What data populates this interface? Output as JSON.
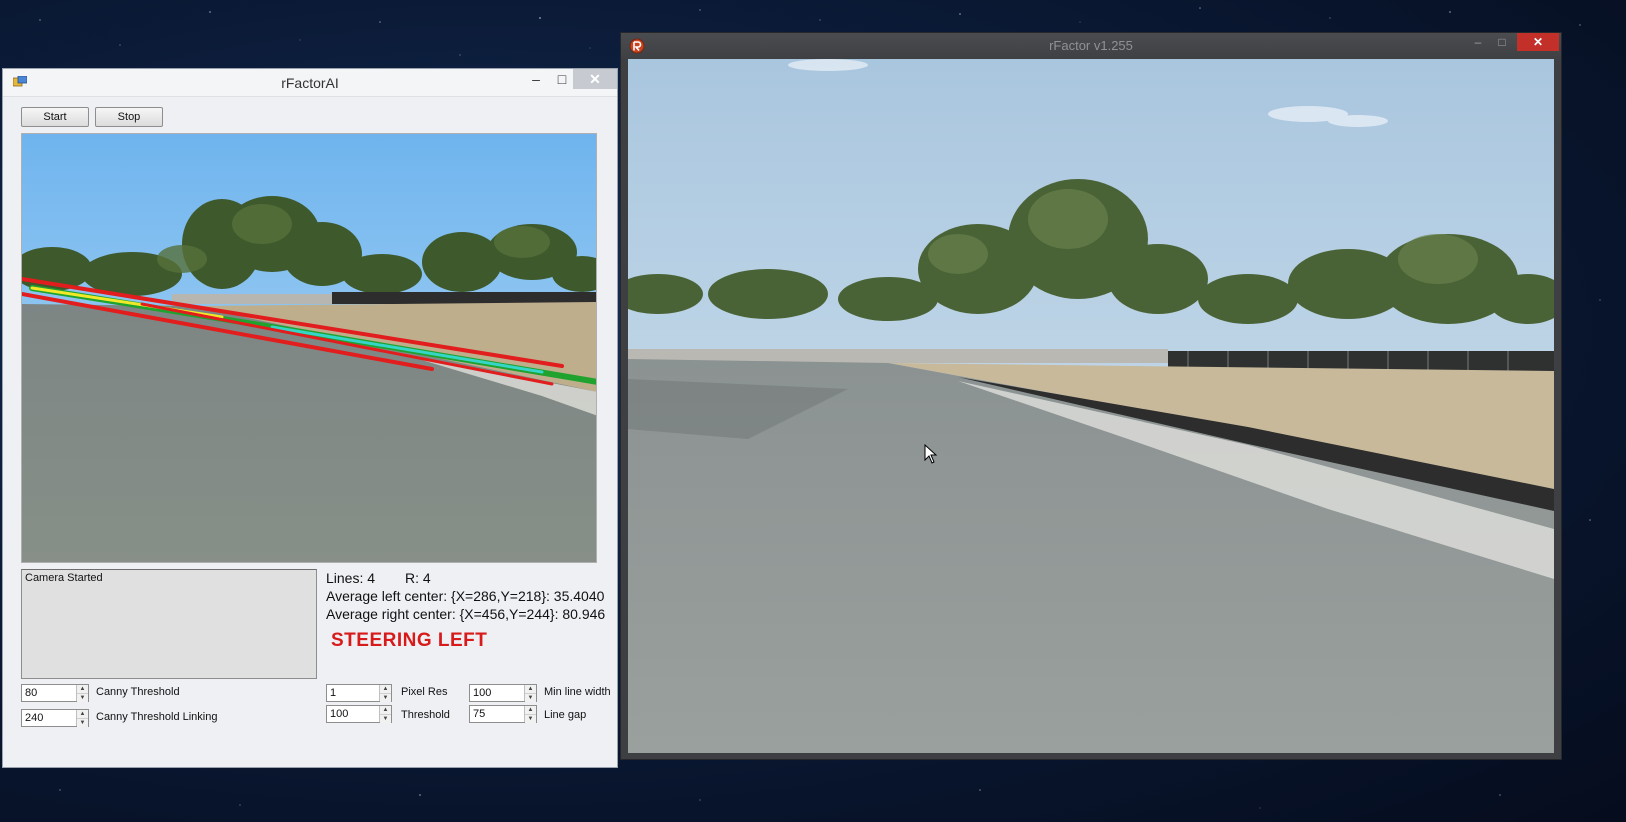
{
  "ai_window": {
    "title": "rFactorAI",
    "minimize_glyph": "–",
    "maximize_glyph": "□",
    "close_glyph": "✕",
    "start_label": "Start",
    "stop_label": "Stop",
    "log_text": "Camera Started",
    "stats": {
      "lines": "Lines: 4",
      "r": "R: 4",
      "avg_left": "Average left center: {X=286,Y=218}: 35.4040",
      "avg_right": "Average right center: {X=456,Y=244}: 80.946"
    },
    "steering_text": "STEERING LEFT",
    "steering_color": "#d81a1a",
    "controls": {
      "canny_threshold": {
        "value": "80",
        "label": "Canny Threshold"
      },
      "canny_threshold_linking": {
        "value": "240",
        "label": "Canny Threshold Linking"
      },
      "pixel_res": {
        "value": "1",
        "label": "Pixel Res"
      },
      "threshold": {
        "value": "100",
        "label": "Threshold"
      },
      "min_line_width": {
        "value": "100",
        "label": "Min line width"
      },
      "line_gap": {
        "value": "75",
        "label": "Line gap"
      }
    },
    "spinner_up_glyph": "▲",
    "spinner_down_glyph": "▼"
  },
  "game_window": {
    "title": "rFactor v1.255",
    "minimize_glyph": "–",
    "maximize_glyph": "□",
    "close_glyph": "✕"
  },
  "icons": {
    "ai_app_icon": "app-icon",
    "game_app_icon": "rfactor-logo-icon",
    "cursor": "mouse-pointer-icon"
  },
  "colors": {
    "detected_line_red": "#e21d1d",
    "detected_line_yellow": "#f1e82a",
    "detected_line_green": "#1fa32e",
    "detected_line_cyan": "#35d6c8"
  }
}
